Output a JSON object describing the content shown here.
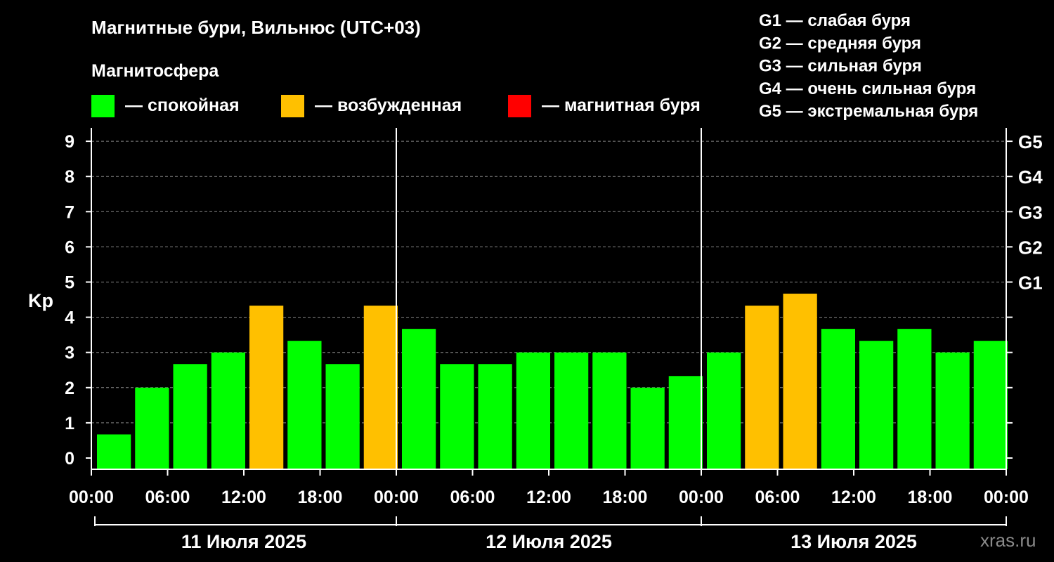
{
  "chart_data": {
    "type": "bar",
    "title": "Магнитные бури, Вильнюс (UTC+03)",
    "legend": {
      "title": "Магнитосфера",
      "items": [
        {
          "label": "— спокойная",
          "color": "#00ff00"
        },
        {
          "label": "— возбужденная",
          "color": "#ffc000"
        },
        {
          "label": "— магнитная буря",
          "color": "#ff0000"
        }
      ]
    },
    "g_scale_legend": [
      "G1 — слабая буря",
      "G2 — средняя буря",
      "G3 — сильная буря",
      "G4 — очень сильная буря",
      "G5 — экстремальная буря"
    ],
    "ylabel": "Kp",
    "ylim": [
      0,
      9
    ],
    "y_ticks": [
      "0",
      "1",
      "2",
      "3",
      "4",
      "5",
      "6",
      "7",
      "8",
      "9"
    ],
    "right_axis": [
      {
        "value": 5,
        "label": "G1"
      },
      {
        "value": 6,
        "label": "G2"
      },
      {
        "value": 7,
        "label": "G3"
      },
      {
        "value": 8,
        "label": "G4"
      },
      {
        "value": 9,
        "label": "G5"
      }
    ],
    "grid": true,
    "x_ticks": [
      "00:00",
      "06:00",
      "12:00",
      "18:00",
      "00:00",
      "06:00",
      "12:00",
      "18:00",
      "00:00",
      "06:00",
      "12:00",
      "18:00",
      "00:00"
    ],
    "days": [
      "11 Июля 2025",
      "12 Июля 2025",
      "13 Июля 2025"
    ],
    "values": [
      0.67,
      2.0,
      2.67,
      3.0,
      4.33,
      3.33,
      2.67,
      4.33,
      3.67,
      2.67,
      2.67,
      3.0,
      3.0,
      3.0,
      2.0,
      2.33,
      3.0,
      4.33,
      4.67,
      3.67,
      3.33,
      3.67,
      3.0,
      3.33
    ],
    "levels": [
      "calm",
      "calm",
      "calm",
      "calm",
      "excited",
      "calm",
      "calm",
      "excited",
      "calm",
      "calm",
      "calm",
      "calm",
      "calm",
      "calm",
      "calm",
      "calm",
      "calm",
      "excited",
      "excited",
      "calm",
      "calm",
      "calm",
      "calm",
      "calm"
    ],
    "colors": {
      "calm": "#00ff00",
      "excited": "#ffc000",
      "storm": "#ff0000",
      "grid": "#888888",
      "axis": "#ffffff"
    }
  },
  "watermark": "xras.ru"
}
